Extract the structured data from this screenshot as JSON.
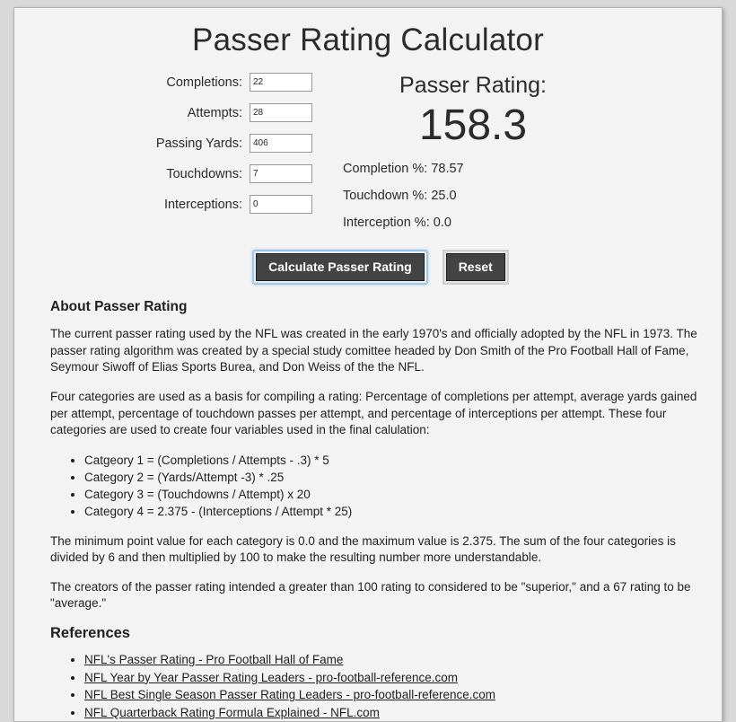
{
  "page": {
    "title": "Passer Rating Calculator"
  },
  "calculator": {
    "fields": [
      {
        "label": "Completions:",
        "value": "22",
        "name": "completions"
      },
      {
        "label": "Attempts:",
        "value": "28",
        "name": "attempts"
      },
      {
        "label": "Passing Yards:",
        "value": "406",
        "name": "passing-yards"
      },
      {
        "label": "Touchdowns:",
        "value": "7",
        "name": "touchdowns"
      },
      {
        "label": "Interceptions:",
        "value": "0",
        "name": "interceptions"
      }
    ],
    "results": {
      "heading": "Passer Rating:",
      "rating": "158.3",
      "stats": [
        "Completion %: 78.57",
        "Touchdown %: 25.0",
        "Interception %: 0.0"
      ]
    },
    "buttons": {
      "calculate": "Calculate Passer Rating",
      "reset": "Reset"
    }
  },
  "about": {
    "heading": "About Passer Rating",
    "paragraph1": "The current passer rating used by the NFL was created in the early 1970's and officially adopted by the NFL in 1973. The passer rating algorithm was created by a special study comittee headed by Don Smith of the Pro Football Hall of Fame, Seymour Siwoff of Elias Sports Burea, and Don Weiss of the the NFL.",
    "paragraph2": "Four categories are used as a basis for compiling a rating: Percentage of completions per attempt, average yards gained per attempt, percentage of touchdown passes per attempt, and percentage of interceptions per attempt. These four categories are used to create four variables used in the final calulation:",
    "categories": [
      "Catgeory 1 = (Completions / Attempts - .3) * 5",
      "Category 2 = (Yards/Attempt -3) * .25",
      "Category 3 = (Touchdowns / Attempt) x 20",
      "Category 4 = 2.375 - (Interceptions / Attempt * 25)"
    ],
    "paragraph3": "The minimum point value for each category is 0.0 and the maximum value is 2.375. The sum of the four categories is divided by 6 and then multiplied by 100 to make the resulting number more understandable.",
    "paragraph4": "The creators of the passer rating intended a greater than 100 rating to considered to be \"superior,\" and a 67 rating to be \"average.\""
  },
  "references": {
    "heading": "References",
    "links": [
      "NFL's Passer Rating - Pro Football Hall of Fame",
      "NFL Year by Year Passer Rating Leaders - pro-football-reference.com",
      "NFL Best Single Season Passer Rating Leaders - pro-football-reference.com",
      "NFL Quarterback Rating Formula Explained - NFL.com"
    ]
  }
}
